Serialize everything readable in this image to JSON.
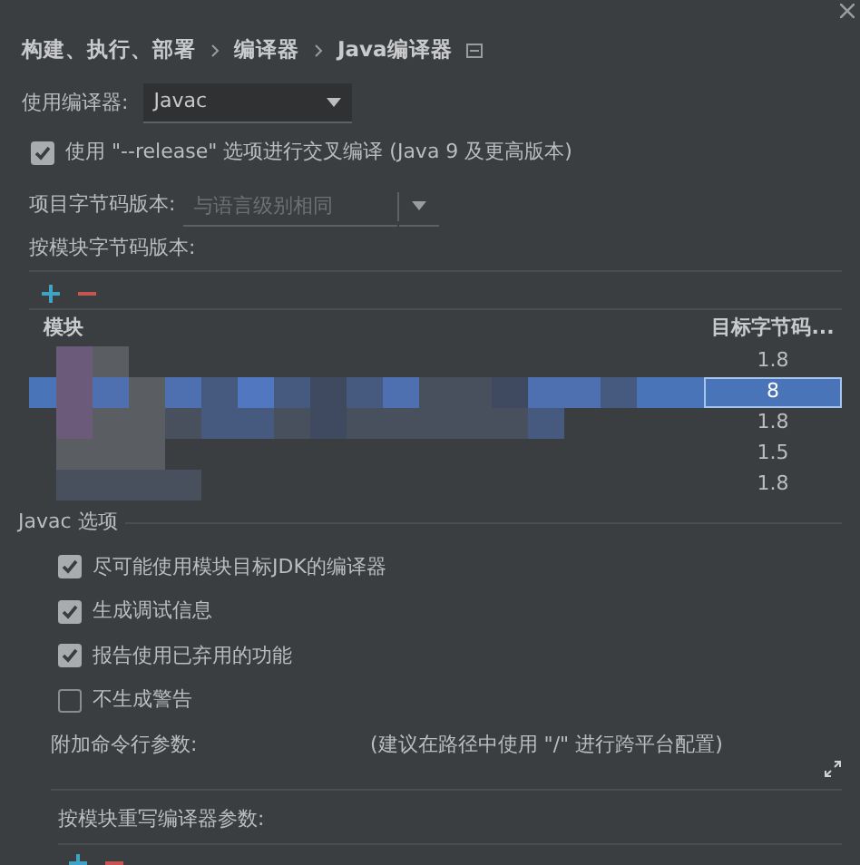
{
  "breadcrumb": [
    "构建、执行、部署",
    "编译器",
    "Java编译器"
  ],
  "compiler": {
    "label": "使用编译器:",
    "value": "Javac"
  },
  "release_option": {
    "label": "使用 \"--release\" 选项进行交叉编译 (Java 9 及更高版本)",
    "checked": true
  },
  "project_bytecode": {
    "label": "项目字节码版本:",
    "placeholder": "与语言级别相同"
  },
  "per_module_label": "按模块字节码版本:",
  "table": {
    "columns": [
      "模块",
      "目标字节码..."
    ],
    "rows": [
      {
        "version": "1.8",
        "selected": false
      },
      {
        "version": "8",
        "selected": true
      },
      {
        "version": "1.8",
        "selected": false
      },
      {
        "version": "1.5",
        "selected": false
      },
      {
        "version": "1.8",
        "selected": false
      }
    ]
  },
  "javac_section": "Javac 选项",
  "options": [
    {
      "label": "尽可能使用模块目标JDK的编译器",
      "checked": true
    },
    {
      "label": "生成调试信息",
      "checked": true
    },
    {
      "label": "报告使用已弃用的功能",
      "checked": true
    },
    {
      "label": "不生成警告",
      "checked": false
    }
  ],
  "additional_args": {
    "label": "附加命令行参数:",
    "hint": "(建议在路径中使用 \"/\" 进行跨平台配置)"
  },
  "override_label": "按模块重写编译器参数:"
}
